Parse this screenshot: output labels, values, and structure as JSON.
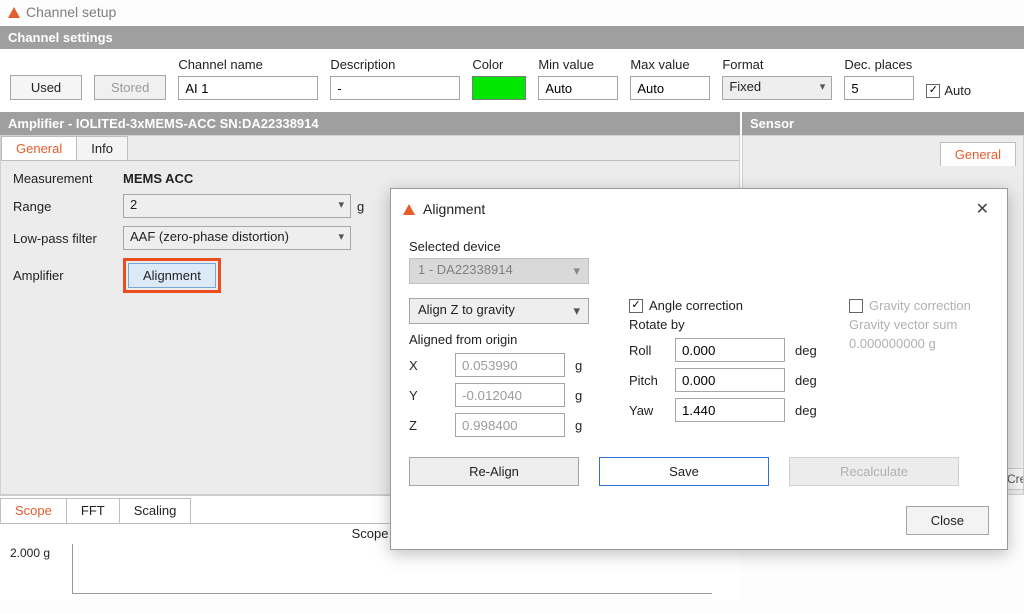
{
  "window": {
    "title": "Channel setup"
  },
  "channel_settings": {
    "header": "Channel settings",
    "used_btn": "Used",
    "stored_btn": "Stored",
    "channel_name": {
      "label": "Channel name",
      "value": "AI 1"
    },
    "description": {
      "label": "Description",
      "value": "-"
    },
    "color": {
      "label": "Color"
    },
    "min_value": {
      "label": "Min value",
      "value": "Auto"
    },
    "max_value": {
      "label": "Max value",
      "value": "Auto"
    },
    "format": {
      "label": "Format",
      "value": "Fixed"
    },
    "dec_places": {
      "label": "Dec. places",
      "value": "5"
    },
    "auto_chk": "Auto"
  },
  "amplifier": {
    "header": "Amplifier - IOLITEd-3xMEMS-ACC  SN:DA22338914",
    "tabs": {
      "general": "General",
      "info": "Info"
    },
    "measurement": {
      "label": "Measurement",
      "value": "MEMS ACC"
    },
    "range": {
      "label": "Range",
      "value": "2",
      "unit": "g"
    },
    "lowpass": {
      "label": "Low-pass filter",
      "value": "AAF (zero-phase distortion)"
    },
    "amp_row": {
      "label": "Amplifier",
      "button": "Alignment"
    }
  },
  "sensor": {
    "header": "Sensor",
    "tabs": {
      "general": "General"
    }
  },
  "scope": {
    "tabs": {
      "scope": "Scope",
      "fft": "FFT",
      "scaling": "Scaling"
    },
    "title": "Scope",
    "y_value": "2.000 g"
  },
  "dialog": {
    "title": "Alignment",
    "selected_device": {
      "label": "Selected device",
      "value": "1 - DA22338914"
    },
    "align_mode": "Align Z to gravity",
    "aligned_from_origin": "Aligned from origin",
    "angle_correction": "Angle correction",
    "gravity_correction": "Gravity correction",
    "rotate_by": "Rotate by",
    "gravity_vector_sum": {
      "label": "Gravity vector sum",
      "value": "0.000000000 g"
    },
    "xyz": {
      "x": {
        "label": "X",
        "value": "0.053990",
        "unit": "g"
      },
      "y": {
        "label": "Y",
        "value": "-0.012040",
        "unit": "g"
      },
      "z": {
        "label": "Z",
        "value": "0.998400",
        "unit": "g"
      }
    },
    "rpy": {
      "roll": {
        "label": "Roll",
        "value": "0.000",
        "unit": "deg"
      },
      "pitch": {
        "label": "Pitch",
        "value": "0.000",
        "unit": "deg"
      },
      "yaw": {
        "label": "Yaw",
        "value": "1.440",
        "unit": "deg"
      }
    },
    "buttons": {
      "realign": "Re-Align",
      "save": "Save",
      "recalc": "Recalculate",
      "close": "Close"
    }
  },
  "fragment": "Crea"
}
